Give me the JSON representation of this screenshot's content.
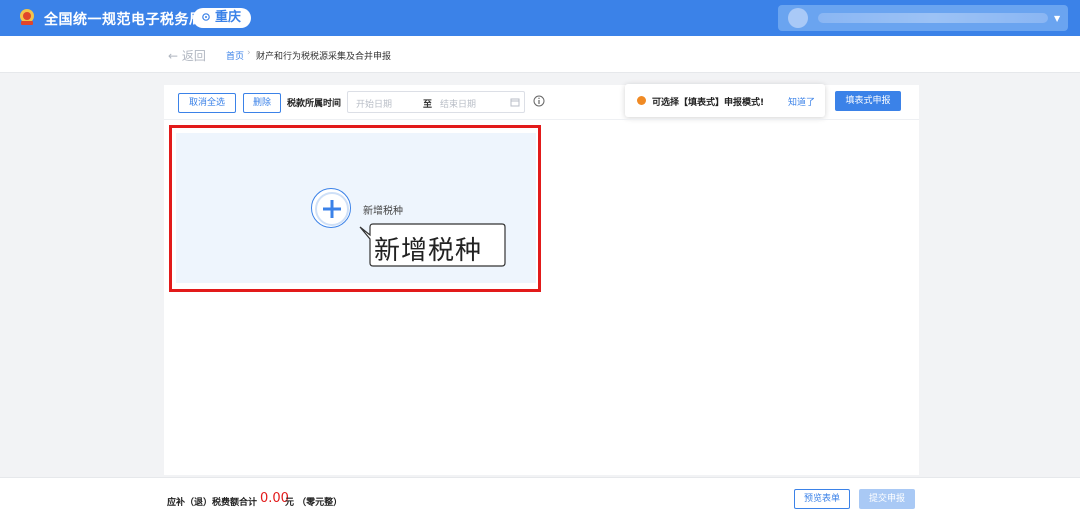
{
  "header": {
    "site_title": "全国统一规范电子税务局",
    "region": "重庆",
    "accent_color": "#3b82e8",
    "logo_icon": "tax-emblem-icon",
    "user_icon": "user-avatar-icon"
  },
  "breadcrumb": {
    "back_label": "← 返回",
    "home": "首页",
    "separator": "›",
    "current": "财产和行为税税源采集及合并申报"
  },
  "toolbar": {
    "cancel_select_all": "取消全选",
    "delete": "删除",
    "period_label": "税款所属时间",
    "date_start_placeholder": "开始日期",
    "date_to": "至",
    "date_end_placeholder": "结束日期",
    "info_icon": "info-icon",
    "calendar_icon": "calendar-icon"
  },
  "tip": {
    "text": "可选择【填表式】申报模式!",
    "link": "知道了",
    "dot_color": "#f08a24"
  },
  "primary_button": "填表式申报",
  "add_card": {
    "label": "新增税种",
    "callout": "新增税种",
    "plus_icon": "plus-icon"
  },
  "highlight_color": "#e21a1a",
  "footer": {
    "total_label": "应补（退）税费额合计",
    "total_value": "0.00",
    "total_unit": "元 （零元整）",
    "preview_button": "预览表单",
    "submit_button": "提交申报"
  }
}
